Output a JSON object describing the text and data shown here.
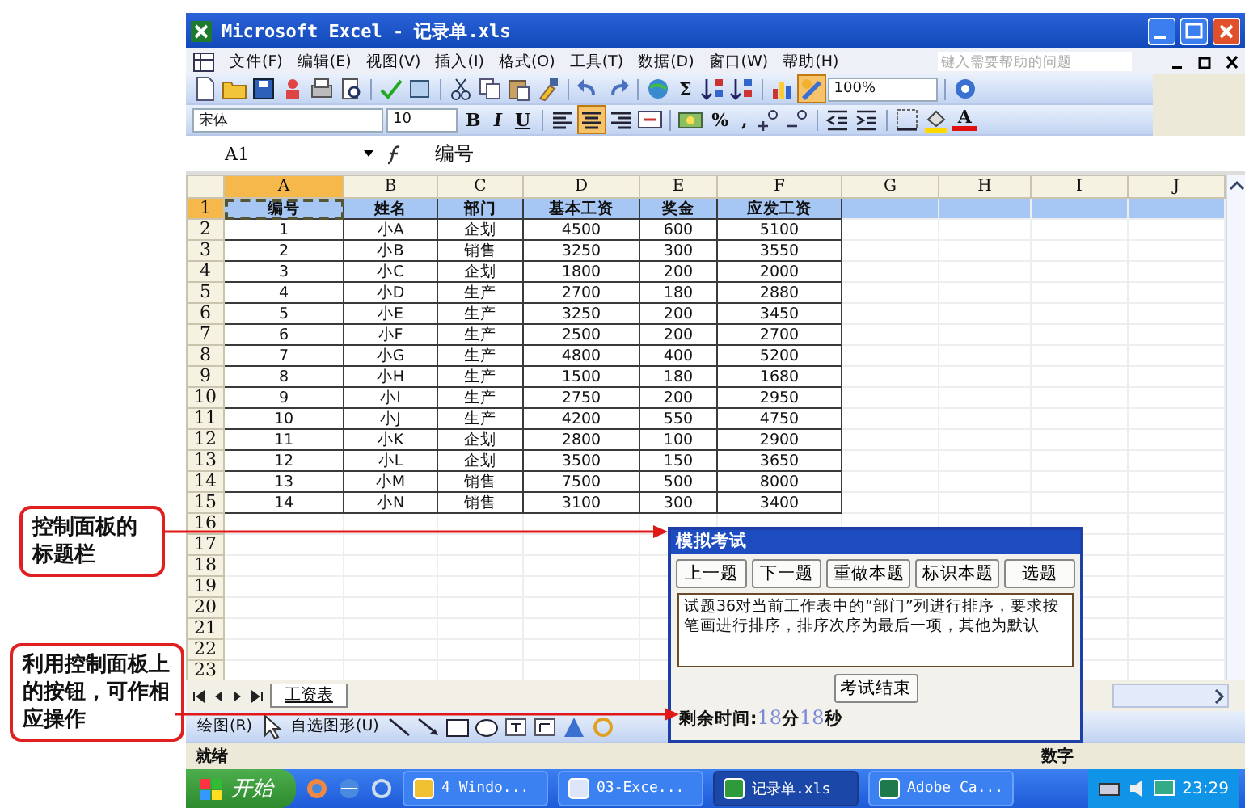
{
  "window": {
    "title": "Microsoft Excel - 记录单.xls"
  },
  "menu": [
    "文件(F)",
    "编辑(E)",
    "视图(V)",
    "插入(I)",
    "格式(O)",
    "工具(T)",
    "数据(D)",
    "窗口(W)",
    "帮助(H)"
  ],
  "help_search": {
    "placeholder": "键入需要帮助的问题"
  },
  "standard_toolbar": {
    "sum": "Σ",
    "zoom": "100%",
    "drawing_button": {
      "selected": true
    }
  },
  "formatting_toolbar": {
    "font": "宋体",
    "size": "10",
    "styles": [
      "B",
      "I",
      "U"
    ],
    "align_buttons": [
      {
        "selected": false
      },
      {
        "selected": true
      },
      {
        "selected": false
      },
      {
        "selected": false
      }
    ],
    "percent": "%",
    "comma": ",",
    "font_color": "A"
  },
  "formula_bar": {
    "name_box": "A1",
    "formula": "编号"
  },
  "columns": [
    {
      "label": "A",
      "selected": true
    },
    {
      "label": "B",
      "selected": false
    },
    {
      "label": "C",
      "selected": false
    },
    {
      "label": "D",
      "selected": false
    },
    {
      "label": "E",
      "selected": false
    },
    {
      "label": "F",
      "selected": false
    },
    {
      "label": "G",
      "selected": false
    },
    {
      "label": "H",
      "selected": false
    },
    {
      "label": "I",
      "selected": false
    },
    {
      "label": "J",
      "selected": false
    }
  ],
  "rows": [
    {
      "number": "1",
      "selected": true,
      "cells": [
        "编号",
        "姓名",
        "部门",
        "基本工资",
        "奖金",
        "应发工资"
      ]
    },
    {
      "number": "2",
      "selected": false,
      "cells": [
        "1",
        "小A",
        "企划",
        "4500",
        "600",
        "5100"
      ]
    },
    {
      "number": "3",
      "selected": false,
      "cells": [
        "2",
        "小B",
        "销售",
        "3250",
        "300",
        "3550"
      ]
    },
    {
      "number": "4",
      "selected": false,
      "cells": [
        "3",
        "小C",
        "企划",
        "1800",
        "200",
        "2000"
      ]
    },
    {
      "number": "5",
      "selected": false,
      "cells": [
        "4",
        "小D",
        "生产",
        "2700",
        "180",
        "2880"
      ]
    },
    {
      "number": "6",
      "selected": false,
      "cells": [
        "5",
        "小E",
        "生产",
        "3250",
        "200",
        "3450"
      ]
    },
    {
      "number": "7",
      "selected": false,
      "cells": [
        "6",
        "小F",
        "生产",
        "2500",
        "200",
        "2700"
      ]
    },
    {
      "number": "8",
      "selected": false,
      "cells": [
        "7",
        "小G",
        "生产",
        "4800",
        "400",
        "5200"
      ]
    },
    {
      "number": "9",
      "selected": false,
      "cells": [
        "8",
        "小H",
        "生产",
        "1500",
        "180",
        "1680"
      ]
    },
    {
      "number": "10",
      "selected": false,
      "cells": [
        "9",
        "小I",
        "生产",
        "2750",
        "200",
        "2950"
      ]
    },
    {
      "number": "11",
      "selected": false,
      "cells": [
        "10",
        "小J",
        "生产",
        "4200",
        "550",
        "4750"
      ]
    },
    {
      "number": "12",
      "selected": false,
      "cells": [
        "11",
        "小K",
        "企划",
        "2800",
        "100",
        "2900"
      ]
    },
    {
      "number": "13",
      "selected": false,
      "cells": [
        "12",
        "小L",
        "企划",
        "3500",
        "150",
        "3650"
      ]
    },
    {
      "number": "14",
      "selected": false,
      "cells": [
        "13",
        "小M",
        "销售",
        "7500",
        "500",
        "8000"
      ]
    },
    {
      "number": "15",
      "selected": false,
      "cells": [
        "14",
        "小N",
        "销售",
        "3100",
        "300",
        "3400"
      ]
    },
    {
      "number": "16",
      "selected": false
    },
    {
      "number": "17",
      "selected": false
    },
    {
      "number": "18",
      "selected": false
    },
    {
      "number": "19",
      "selected": false
    },
    {
      "number": "20",
      "selected": false
    },
    {
      "number": "21",
      "selected": false
    },
    {
      "number": "22",
      "selected": false
    },
    {
      "number": "23",
      "selected": false
    }
  ],
  "sheet_tabs": [
    {
      "label": "工资表",
      "selected": true
    }
  ],
  "drawing_toolbar": {
    "draw_menu": "绘图(R)",
    "autoshapes_menu": "自选图形(U)"
  },
  "status_bar": {
    "left": "就绪",
    "right": "数字"
  },
  "taskbar": {
    "start": "开始",
    "tasks": [
      {
        "label": "4 Windo...",
        "selected": false
      },
      {
        "label": "03-Exce...",
        "selected": false
      },
      {
        "label": "记录单.xls",
        "selected": true
      },
      {
        "label": "Adobe Ca...",
        "selected": false
      }
    ],
    "clock": "23:29"
  },
  "exam_panel": {
    "title": "模拟考试",
    "buttons": [
      "上一题",
      "下一题",
      "重做本题",
      "标识本题",
      "选题"
    ],
    "question": "试题36对当前工作表中的“部门”列进行排序，要求按笔画进行排序，排序次序为最后一项，其他为默认",
    "end_button": "考试结束",
    "timer": {
      "label": "剩余时间:",
      "minutes": "18",
      "minutes_unit": "分",
      "seconds": "18",
      "seconds_unit": "秒"
    }
  },
  "callouts": [
    "控制面板的标题栏",
    "利用控制面板上的按钮，可作相应操作"
  ]
}
